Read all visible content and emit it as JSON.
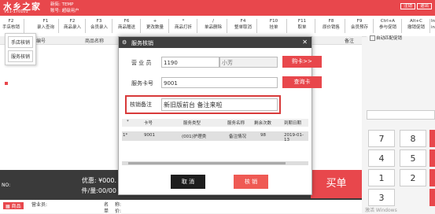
{
  "app": {
    "logo": "水乡之家",
    "version": "V11-170101",
    "store_line": "新街: TEMP",
    "account_line": "账号:            超级用户",
    "top_buttons": [
      "注销",
      "退出"
    ]
  },
  "fkeys": [
    {
      "k": "F2",
      "l": "手店核销"
    },
    {
      "k": "F1",
      "l": "录入查询"
    },
    {
      "k": "F2",
      "l": "商品录入"
    },
    {
      "k": "F3",
      "l": "会员录入"
    },
    {
      "k": "F6",
      "l": "商品赠送"
    },
    {
      "k": "+",
      "l": "更改数量"
    },
    {
      "k": "*",
      "l": "商品打折"
    },
    {
      "k": "/",
      "l": "单品删除"
    },
    {
      "k": "F4",
      "l": "整单取消"
    },
    {
      "k": "F10",
      "l": "挂单"
    },
    {
      "k": "F11",
      "l": "取单"
    },
    {
      "k": "F8",
      "l": "原价销售"
    },
    {
      "k": "F9",
      "l": "会员预存"
    },
    {
      "k": "Ctrl+A",
      "l": "参与促销"
    },
    {
      "k": "Alt+C",
      "l": "撤销促销"
    },
    {
      "k": "Ins",
      "l": "ins"
    }
  ],
  "popup_menu": [
    "手店核销",
    "服务核销"
  ],
  "grid_header": [
    "编号",
    "商品名称",
    "备注"
  ],
  "auto_option": "自动匹配促销",
  "keypad": [
    "7",
    "8",
    "4",
    "5",
    "1",
    "2",
    "3"
  ],
  "amount": {
    "no": "NO:",
    "discount": "优惠: ¥000.",
    "count": "件/量:00/00"
  },
  "buy": "买单",
  "info": {
    "tag": "商品",
    "labels": [
      "营业员:",
      "名",
      "称:",
      "单",
      "价:"
    ]
  },
  "watermark": "激活 Windows",
  "dialog": {
    "title": "服务核销",
    "staff_label": "营 业 员",
    "staff_code": "1190",
    "staff_name": "小芳",
    "buy_card": "购卡>>",
    "card_label": "服务卡号",
    "card_no": "9001",
    "query_card": "查询卡",
    "note_label": "核销备注",
    "note_value": "新旧版前台 备注来啦",
    "columns": [
      "*",
      "卡号",
      "服务类型",
      "服务名称",
      "剩余次数",
      "到期日期"
    ],
    "rows": [
      {
        "idx": "1*",
        "card": "9001",
        "type": "(001)护理类",
        "name": "备注情况",
        "left": "98",
        "date": "2019-01-13"
      }
    ],
    "cancel": "取 消",
    "confirm": "核 销"
  }
}
